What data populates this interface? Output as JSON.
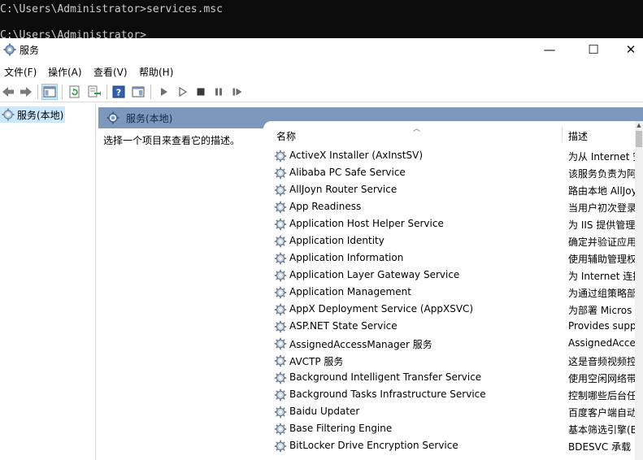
{
  "console": {
    "line1": "C:\\Users\\Administrator>services.msc",
    "line2": "C:\\Users\\Administrator>"
  },
  "window": {
    "title": "服务",
    "controls": {
      "minimize": "—",
      "maximize": "☐",
      "close": "✕"
    }
  },
  "menu": [
    "文件(F)",
    "操作(A)",
    "查看(V)",
    "帮助(H)"
  ],
  "tree": {
    "root": "服务(本地)"
  },
  "content": {
    "header": "服务(本地)",
    "prompt": "选择一个项目来查看它的描述。",
    "columns": {
      "name": "名称",
      "description": "描述"
    }
  },
  "services": [
    {
      "name": "ActiveX Installer (AxInstSV)",
      "desc": "为从 Internet 安"
    },
    {
      "name": "Alibaba PC Safe Service",
      "desc": "该服务负责为阿"
    },
    {
      "name": "AllJoyn Router Service",
      "desc": "路由本地 AllJoy"
    },
    {
      "name": "App Readiness",
      "desc": "当用户初次登录"
    },
    {
      "name": "Application Host Helper Service",
      "desc": "为 IIS 提供管理"
    },
    {
      "name": "Application Identity",
      "desc": "确定并验证应用"
    },
    {
      "name": "Application Information",
      "desc": "使用辅助管理权"
    },
    {
      "name": "Application Layer Gateway Service",
      "desc": "为 Internet 连接"
    },
    {
      "name": "Application Management",
      "desc": "为通过组策略部"
    },
    {
      "name": "AppX Deployment Service (AppXSVC)",
      "desc": "为部署 Micros"
    },
    {
      "name": "ASP.NET State Service",
      "desc": "Provides supp"
    },
    {
      "name": "AssignedAccessManager 服务",
      "desc": "AssignedAcce"
    },
    {
      "name": "AVCTP 服务",
      "desc": "这是音频视频控"
    },
    {
      "name": "Background Intelligent Transfer Service",
      "desc": "使用空闲网络带"
    },
    {
      "name": "Background Tasks Infrastructure Service",
      "desc": "控制哪些后台任"
    },
    {
      "name": "Baidu Updater",
      "desc": "百度客户端自动"
    },
    {
      "name": "Base Filtering Engine",
      "desc": "基本筛选引擎(B"
    },
    {
      "name": "BitLocker Drive Encryption Service",
      "desc": "BDESVC 承载 B"
    }
  ],
  "toolbar_icons": [
    "back-arrow-icon",
    "forward-arrow-icon",
    "show-hide-tree-icon",
    "refresh-icon",
    "export-list-icon",
    "help-icon",
    "properties-icon",
    "start-service-icon",
    "start-service-alt-icon",
    "stop-service-icon",
    "pause-service-icon",
    "resume-service-icon"
  ],
  "colors": {
    "header_bar": "#7c98bd",
    "selection": "#cce8ff",
    "console_bg": "#0c0c0c"
  }
}
